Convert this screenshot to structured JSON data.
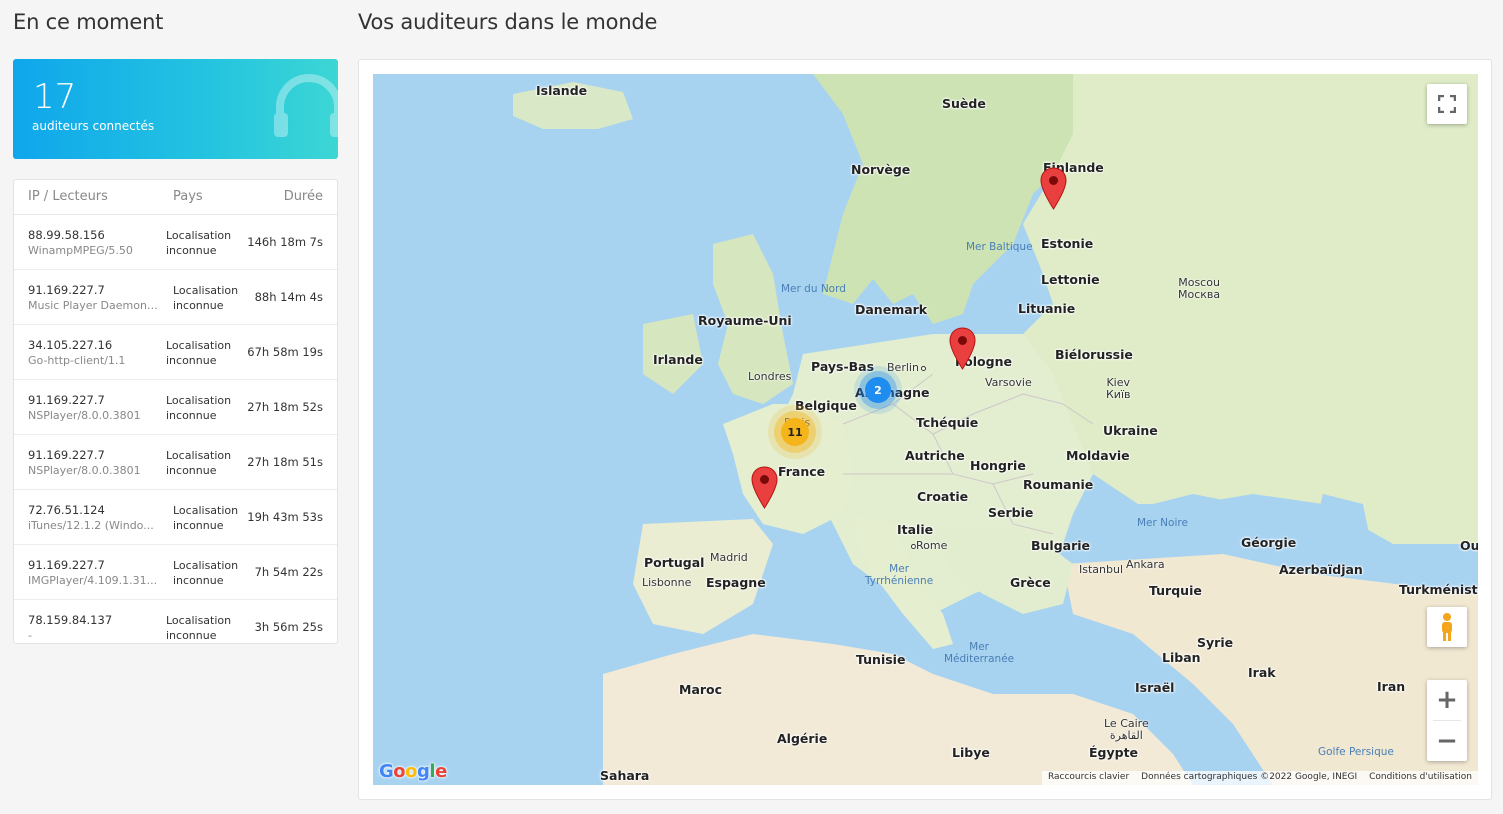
{
  "left_panel": {
    "title": "En ce moment",
    "stat": {
      "count": "17",
      "label": "auditeurs connectés",
      "icon": "headphones-icon"
    },
    "table": {
      "headers": {
        "ip": "IP / Lecteurs",
        "country": "Pays",
        "duration": "Durée"
      },
      "rows": [
        {
          "ip": "88.99.58.156",
          "agent": "WinampMPEG/5.50",
          "location": "Localisation inconnue",
          "duration": "146h 18m 7s"
        },
        {
          "ip": "91.169.227.7",
          "agent": "Music Player Daemon ...",
          "location": "Localisation inconnue",
          "duration": "88h 14m 4s"
        },
        {
          "ip": "34.105.227.16",
          "agent": "Go-http-client/1.1",
          "location": "Localisation inconnue",
          "duration": "67h 58m 19s"
        },
        {
          "ip": "91.169.227.7",
          "agent": "NSPlayer/8.0.0.3801",
          "location": "Localisation inconnue",
          "duration": "27h 18m 52s"
        },
        {
          "ip": "91.169.227.7",
          "agent": "NSPlayer/8.0.0.3801",
          "location": "Localisation inconnue",
          "duration": "27h 18m 51s"
        },
        {
          "ip": "72.76.51.124",
          "agent": "iTunes/12.1.2 (Windo...",
          "location": "Localisation inconnue",
          "duration": "19h 43m 53s"
        },
        {
          "ip": "91.169.227.7",
          "agent": "IMGPlayer/4.109.1.31...",
          "location": "Localisation inconnue",
          "duration": "7h 54m 22s"
        },
        {
          "ip": "78.159.84.137",
          "agent": "-",
          "location": "Localisation inconnue",
          "duration": "3h 56m 25s"
        }
      ]
    }
  },
  "right_panel": {
    "title": "Vos auditeurs dans le monde",
    "map": {
      "countries": {
        "islande": "Islande",
        "suede": "Suède",
        "norvege": "Norvège",
        "finlande": "Finlande",
        "estonie": "Estonie",
        "lettonie": "Lettonie",
        "lituanie": "Lituanie",
        "danemark": "Danemark",
        "royaume_uni": "Royaume-Uni",
        "irlande": "Irlande",
        "pays_bas": "Pays-Bas",
        "belgique": "Belgique",
        "allemagne": "Allemagne",
        "pologne": "Pologne",
        "bielorussie": "Biélorussie",
        "tchequie": "Tchéquie",
        "ukraine": "Ukraine",
        "france": "France",
        "autriche": "Autriche",
        "hongrie": "Hongrie",
        "moldavie": "Moldavie",
        "roumanie": "Roumanie",
        "croatie": "Croatie",
        "serbie": "Serbie",
        "italie": "Italie",
        "bulgarie": "Bulgarie",
        "portugal": "Portugal",
        "espagne": "Espagne",
        "grece": "Grèce",
        "turquie": "Turquie",
        "georgie": "Géorgie",
        "azerbaidjan": "Azerbaïdjan",
        "turkmenistan": "Turkménista",
        "syrie": "Syrie",
        "liban": "Liban",
        "irak": "Irak",
        "tunisie": "Tunisie",
        "maroc": "Maroc",
        "israel": "Israël",
        "iran": "Iran",
        "algerie": "Algérie",
        "libye": "Libye",
        "egypte": "Égypte",
        "sahara": "Sahara",
        "ou": "Ou"
      },
      "seas": {
        "mer_baltique": "Mer Baltique",
        "mer_du_nord": "Mer du Nord",
        "mer_noire": "Mer Noire",
        "mer_tyrrhenienne_1": "Mer",
        "mer_tyrrhenienne_2": "Tyrrhénienne",
        "mer_med_1": "Mer",
        "mer_med_2": "Méditerranée",
        "golfe_persique": "Golfe Persique"
      },
      "cities": {
        "berlin": "Berlin",
        "varsovie": "Varsovie",
        "moscou_1": "Moscou",
        "moscou_2": "Москва",
        "kiev_1": "Kiev",
        "kiev_2": "Київ",
        "londres": "Londres",
        "paris": "Paris",
        "madrid": "Madrid",
        "lisbonne": "Lisbonne",
        "rome": "Rome",
        "istanbul": "Istanbul",
        "ankara": "Ankara",
        "le_caire_1": "Le Caire",
        "le_caire_2": "القاهرة"
      },
      "clusters": {
        "germany": "2",
        "paris": "11"
      },
      "attribution": {
        "shortcuts": "Raccourcis clavier",
        "data": "Données cartographiques ©2022 Google, INEGI",
        "terms": "Conditions d'utilisation"
      },
      "logo": "Google",
      "colors": {
        "water": "#a7d3f1",
        "land": "#e8f0d8",
        "forest": "#cde3b4",
        "desert": "#f2ead7",
        "pin": "#ea3f3f"
      }
    }
  }
}
